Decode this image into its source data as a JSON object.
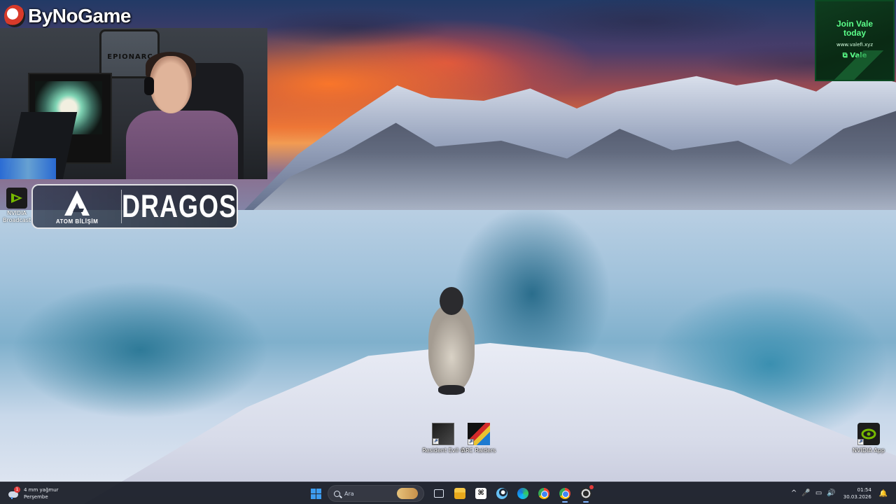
{
  "overlay": {
    "channel_name": "ByNoGame",
    "webcam_sign": "EPIONARC",
    "nvidia_broadcast_label": "NVIDIA Broadcast",
    "sponsor": {
      "left_brand": "ATOM BİLİŞİM",
      "right_brand": "DRAGOS"
    },
    "promo": {
      "title_line1": "Join Vale",
      "title_line2": "today",
      "url": "www.valefi.xyz",
      "brand": "Vale"
    }
  },
  "desktop": {
    "icons": [
      {
        "label": "Resident Evil 4",
        "icon": "resident-evil-4-icon"
      },
      {
        "label": "ARC Raiders",
        "icon": "arc-raiders-icon"
      },
      {
        "label": "NVIDIA App",
        "icon": "nvidia-app-icon"
      }
    ]
  },
  "taskbar": {
    "weather": {
      "temp": "4 mm yağmur",
      "day": "Perşembe",
      "badge": "1"
    },
    "search_placeholder": "Ara",
    "capcut_glyph": "⌘",
    "apps": [
      {
        "name": "start",
        "icon": "windows-start-icon"
      },
      {
        "name": "task-view",
        "icon": "task-view-icon"
      },
      {
        "name": "file-explorer",
        "icon": "folder-icon"
      },
      {
        "name": "capcut",
        "icon": "capcut-icon"
      },
      {
        "name": "steam",
        "icon": "steam-icon"
      },
      {
        "name": "edge",
        "icon": "edge-icon"
      },
      {
        "name": "chrome",
        "icon": "chrome-icon"
      },
      {
        "name": "chrome-profile",
        "icon": "chrome-icon"
      },
      {
        "name": "obs",
        "icon": "obs-icon"
      }
    ],
    "tray": {
      "chevron": "^",
      "mic": "🎤",
      "network": "▭",
      "volume": "🔊",
      "bell": "🔔"
    },
    "clock": {
      "time": "01:54",
      "date": "30.03.2026"
    }
  },
  "colors": {
    "taskbar_bg": "#161a24",
    "accent": "#3d9cf0",
    "vale_green": "#5cff8a",
    "nvidia_green": "#76b900"
  }
}
